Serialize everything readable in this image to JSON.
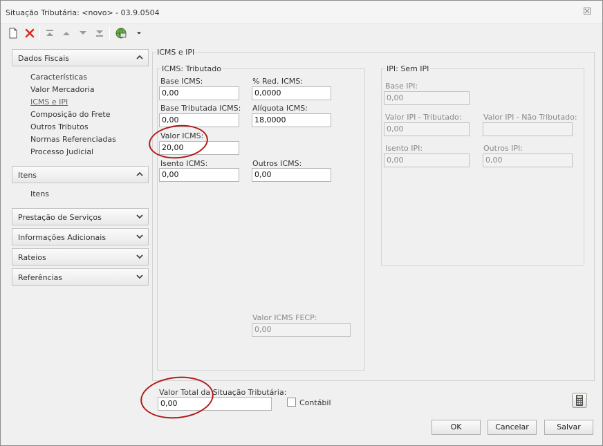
{
  "window": {
    "title": "Situação Tributária: <novo> - 03.9.0504",
    "close_glyph": "☒"
  },
  "toolbar": {
    "icons": [
      "new-document-icon",
      "delete-icon",
      "move-first-icon",
      "move-up-icon",
      "move-down-icon",
      "move-last-icon",
      "globe-settings-icon",
      "dropdown-arrow-icon"
    ]
  },
  "sidebar": {
    "groups": [
      {
        "label": "Dados Fiscais",
        "expanded": true,
        "items": [
          "Características",
          "Valor Mercadoria",
          "ICMS e IPI",
          "Composição do Frete",
          "Outros Tributos",
          "Normas Referenciadas",
          "Processo Judicial"
        ],
        "active_item": "ICMS e IPI"
      },
      {
        "label": "Itens",
        "expanded": true,
        "items": [
          "Itens"
        ]
      },
      {
        "label": "Prestação de Serviços",
        "expanded": false
      },
      {
        "label": "Informações Adicionais",
        "expanded": false
      },
      {
        "label": "Rateios",
        "expanded": false
      },
      {
        "label": "Referências",
        "expanded": false
      }
    ]
  },
  "main": {
    "title": "ICMS e IPI",
    "icms": {
      "title": "ICMS: Tributado",
      "base_icms_label": "Base ICMS:",
      "base_icms_value": "0,00",
      "red_icms_label": "% Red. ICMS:",
      "red_icms_value": "0,0000",
      "base_tributada_label": "Base Tributada ICMS:",
      "base_tributada_value": "0,00",
      "aliquota_label": "Alíquota ICMS:",
      "aliquota_value": "18,0000",
      "valor_icms_label": "Valor ICMS:",
      "valor_icms_value": "20,00",
      "isento_icms_label": "Isento ICMS:",
      "isento_icms_value": "0,00",
      "outros_icms_label": "Outros ICMS:",
      "outros_icms_value": "0,00",
      "fecp_label": "Valor ICMS FECP:",
      "fecp_value": "0,00"
    },
    "ipi": {
      "title": "IPI: Sem IPI",
      "base_ipi_label": "Base IPI:",
      "base_ipi_value": "0,00",
      "valor_trib_label": "Valor IPI - Tributado:",
      "valor_trib_value": "0,00",
      "valor_nao_trib_label": "Valor IPI - Não Tributado:",
      "valor_nao_trib_value": "",
      "isento_ipi_label": "Isento IPI:",
      "isento_ipi_value": "0,00",
      "outros_ipi_label": "Outros IPI:",
      "outros_ipi_value": "0,00"
    }
  },
  "footer": {
    "valor_total_label": "Valor Total da Situação Tributária:",
    "valor_total_value": "0,00",
    "contabil_label": "Contábil",
    "contabil_checked": false,
    "ok_label": "OK",
    "cancel_label": "Cancelar",
    "save_label": "Salvar"
  },
  "colors": {
    "highlight_ellipse": "#b01a1a",
    "delete_red": "#d9261c",
    "window_bg": "#f0f0f0"
  }
}
